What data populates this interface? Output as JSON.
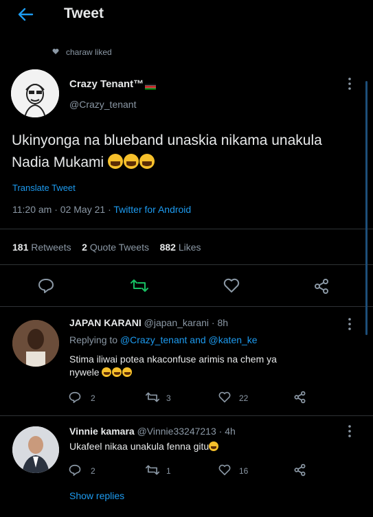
{
  "header": {
    "title": "Tweet"
  },
  "social_context": {
    "text": "charaw liked"
  },
  "tweet": {
    "author_name": "Crazy Tenant™",
    "author_handle": "@Crazy_tenant",
    "text": "Ukinyonga na blueband unaskia nikama unakula Nadia Mukami",
    "translate_label": "Translate Tweet",
    "time": "11:20 am",
    "date": "02 May 21",
    "source": "Twitter for Android",
    "retweets_count": "181",
    "retweets_label": "Retweets",
    "quotes_count": "2",
    "quotes_label": "Quote Tweets",
    "likes_count": "882",
    "likes_label": "Likes",
    "retweet_color": "#17bf63"
  },
  "replies": [
    {
      "name": "JAPAN KARANI",
      "handle": "@japan_karani",
      "time": "8h",
      "replying_prefix": "Replying to",
      "replying_to": "@Crazy_tenant and @katen_ke",
      "text_line1": "Stima iliwai potea nkaconfuse arimis na chem ya",
      "text_line2": "nywele",
      "reply_count": "2",
      "retweet_count": "3",
      "like_count": "22"
    },
    {
      "name": "Vinnie kamara",
      "handle": "@Vinnie33247213",
      "time": "4h",
      "text_line1": "Ukafeel nikaa unakula fenna gitu",
      "reply_count": "2",
      "retweet_count": "1",
      "like_count": "16"
    }
  ],
  "show_replies_label": "Show replies",
  "colors": {
    "accent": "#1d9bf0",
    "background": "#000000",
    "muted": "#8b98a5",
    "retweet": "#17bf63"
  }
}
